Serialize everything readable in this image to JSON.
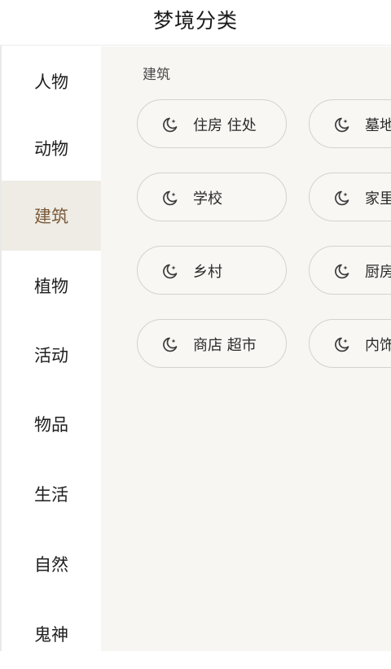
{
  "header": {
    "title": "梦境分类"
  },
  "sidebar": {
    "items": [
      {
        "label": "人物"
      },
      {
        "label": "动物"
      },
      {
        "label": "建筑"
      },
      {
        "label": "植物"
      },
      {
        "label": "活动"
      },
      {
        "label": "物品"
      },
      {
        "label": "生活"
      },
      {
        "label": "自然"
      },
      {
        "label": "鬼神"
      }
    ],
    "active_index": 2
  },
  "content": {
    "section_title": "建筑",
    "chips": [
      {
        "label": "住房 住处",
        "icon": "moon-star-icon"
      },
      {
        "label": "墓地",
        "icon": "moon-star-icon"
      },
      {
        "label": "学校",
        "icon": "moon-star-icon"
      },
      {
        "label": "家里",
        "icon": "moon-star-icon"
      },
      {
        "label": "乡村",
        "icon": "moon-star-icon"
      },
      {
        "label": "厨房",
        "icon": "moon-star-icon"
      },
      {
        "label": "商店 超市",
        "icon": "moon-star-icon"
      },
      {
        "label": "内饰",
        "icon": "moon-star-icon"
      }
    ]
  },
  "colors": {
    "active_bg": "#efece5",
    "active_text": "#7a5a3a",
    "content_bg": "#f7f6f3",
    "chip_border": "#d4d2cd"
  }
}
